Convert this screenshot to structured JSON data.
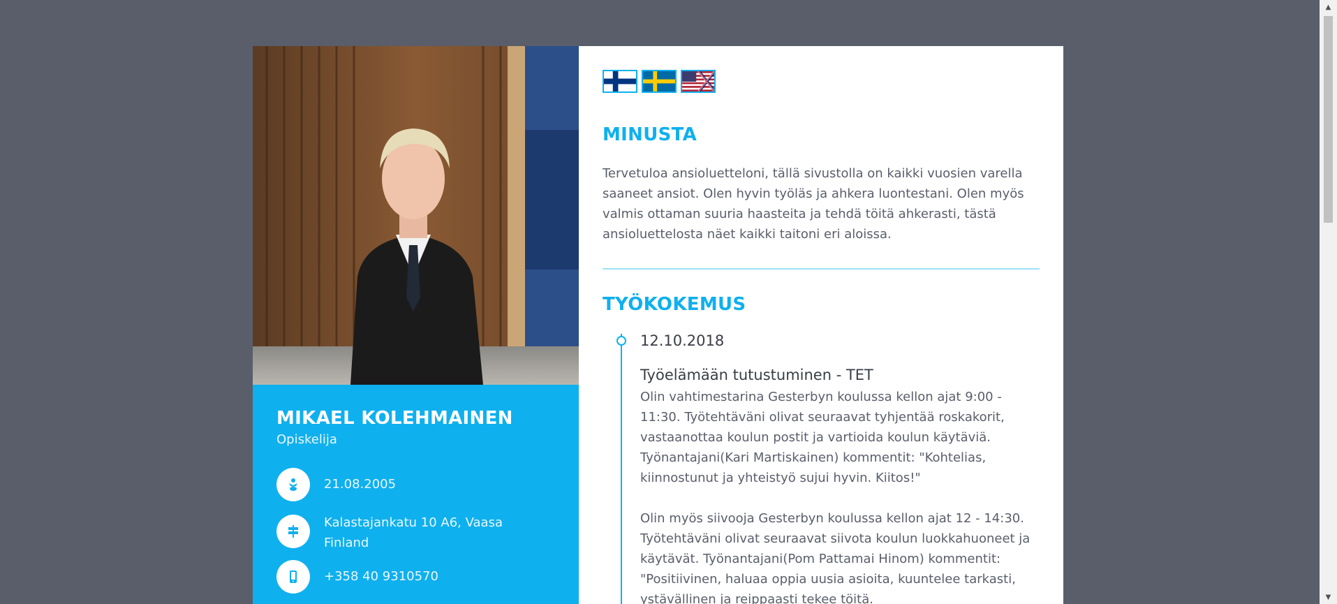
{
  "languages": [
    {
      "name": "Suomi",
      "icon": "finland-flag-icon"
    },
    {
      "name": "Svenska",
      "icon": "sweden-flag-icon"
    },
    {
      "name": "English",
      "icon": "uk-us-flag-icon"
    }
  ],
  "profile": {
    "name": "MIKAEL KOLEHMAINEN",
    "role": "Opiskelija",
    "birthdate": "21.08.2005",
    "address": "Kalastajankatu 10 A6, Vaasa Finland",
    "phone": "+358 40 9310570",
    "icons": {
      "birthdate": "baby-icon",
      "address": "signpost-icon",
      "phone": "mobile-phone-icon"
    }
  },
  "about": {
    "heading": "MINUSTA",
    "text": "Tervetuloa ansioluetteloni, tällä sivustolla on kaikki vuosien varella saaneet ansiot. Olen hyvin työläs ja ahkera luontestani. Olen myös valmis ottaman suuria haasteita ja tehdä töitä ahkerasti, tästä ansioluettelosta näet kaikki taitoni eri aloissa."
  },
  "experience": {
    "heading": "TYÖKOKEMUS",
    "date": "12.10.2018",
    "title": "Työelämään tutustuminen - TET",
    "paragraph1": "Olin vahtimestarina Gesterbyn koulussa kellon ajat 9:00 - 11:30. Työtehtäväni olivat seuraavat tyhjentää roskakorit, vastaanottaa koulun postit ja vartioida koulun käytäviä. Työnantajani(Kari Martiskainen) kommentit: \"Kohtelias, kiinnostunut ja yhteistyö sujui hyvin. Kiitos!\"",
    "paragraph2": "Olin myös siivooja Gesterbyn koulussa kellon ajat 12 - 14:30. Työtehtäväni olivat seuraavat siivota koulun luokkahuoneet ja käytävät. Työnantajani(Pom Pattamai Hinom) kommentit: \"Positiivinen, haluaa oppia uusia asioita, kuuntelee tarkasti, ystävällinen ja reippaasti tekee töitä."
  },
  "colors": {
    "accent": "#0fb0ee",
    "page_background": "#5a5e6b",
    "text": "#5a5e6b"
  }
}
